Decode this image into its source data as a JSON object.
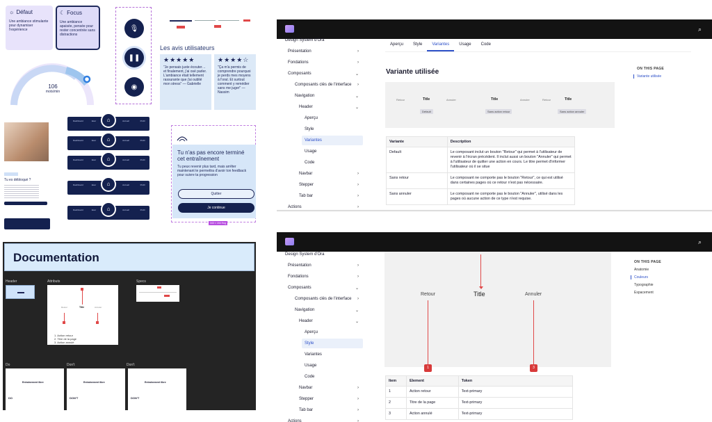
{
  "collage": {
    "card_default": {
      "title": "Défaut",
      "text": "Une ambiance stimulante pour dynamiser l'expérience"
    },
    "card_focus": {
      "title": "Focus",
      "text": "Une ambiance apaisée, pensée pour rester concentrée sans distractions"
    },
    "gauge": {
      "value": "106",
      "unit": "mots/min"
    },
    "avis_title": "Les avis utilisateurs",
    "reviews": [
      {
        "stars": "★★★★★",
        "text": "\"Je pensais juste écouter… et finalement, j'ai osé parler. L'ambiance était tellement rassurante que j'ai oublié mon stress\" — Gabrielle"
      },
      {
        "stars": "★★★★☆",
        "text": "\"Ça m'a permis de comprendre pourquoi je perds mes moyens à l'oral. Et surtout comment y remédier sans me juger\" — Nassim"
      }
    ],
    "navbar_labels": [
      "Dashboard",
      "Exer",
      "Accueil",
      "Profil"
    ],
    "phone_title": "Tu es débloqué ?",
    "modal": {
      "title": "Tu n'as pas encore terminé cet entraînement",
      "text": "Tu peux revenir plus tard, mais arrêter maintenant te permettra d'avoir ton feedback pour suivre ta progression",
      "quit": "Quitter",
      "continue": "Je continue",
      "size": "343 × 154 Hug"
    },
    "documentation": {
      "title": "Documentation",
      "labels": {
        "header": "Header",
        "attributs": "Attributs",
        "specs": "Specs",
        "do": "Do",
        "dont1": "Don't",
        "dont2": "Don't"
      },
      "attr_list": [
        "1. Action retour",
        "2. Titre de la page",
        "3. Action annulé"
      ],
      "attr_row": [
        "Retour",
        "Title",
        "Annuler"
      ],
      "card_titles": [
        "Entraînement libre",
        "Entraînement libre",
        "Entraînement libre"
      ],
      "card_tags": [
        "DO",
        "DON'T",
        "DON'T"
      ]
    }
  },
  "panel1": {
    "site_title": "Design System d'Ora",
    "sidebar": [
      {
        "label": "Présentation",
        "chev": "›"
      },
      {
        "label": "Fondations",
        "chev": "›"
      },
      {
        "label": "Composants",
        "chev": "⌄"
      },
      {
        "label": "Composants clés de l'interface",
        "chev": "›"
      },
      {
        "label": "Navigation",
        "chev": "⌄"
      },
      {
        "label": "Header",
        "chev": "⌄"
      },
      {
        "label": "Aperçu",
        "chev": ""
      },
      {
        "label": "Style",
        "chev": ""
      },
      {
        "label": "Variantes",
        "chev": ""
      },
      {
        "label": "Usage",
        "chev": ""
      },
      {
        "label": "Code",
        "chev": ""
      },
      {
        "label": "Navbar",
        "chev": "›"
      },
      {
        "label": "Stepper",
        "chev": "›"
      },
      {
        "label": "Tab bar",
        "chev": "›"
      },
      {
        "label": "Actions",
        "chev": "›"
      }
    ],
    "tabs": [
      "Aperçu",
      "Style",
      "Variantes",
      "Usage",
      "Code"
    ],
    "heading": "Variante utilisée",
    "otp_title": "ON THIS PAGE",
    "otp_items": [
      "Variante utilisée"
    ],
    "preview": {
      "retour": "Retour",
      "title": "Title",
      "annuler": "Annuler",
      "chips": [
        "Default",
        "Sans action retour",
        "Sans action annuler"
      ]
    },
    "table": {
      "headers": [
        "Variante",
        "Description"
      ],
      "rows": [
        [
          "Default",
          "Le composant inclut un bouton \"Retour\" qui permet à l'utilisateur de revenir à l'écran précédent. Il inclut aussi un bouton \"Annuler\" qui permet à l'utilisateur de quitter une action en cours. Le titre permet d'informer l'utilisateur où il se situe"
        ],
        [
          "Sans retour",
          "Le composant ne comporte pas le bouton \"Retour\", ce qui est utilisé dans certaines pages où ce retour n'est pas nécessaire."
        ],
        [
          "Sans annuler",
          "Le composant ne comporte pas le bouton \"Annuler\", utilisé dans les pages où aucune action de ce type n'est requise."
        ]
      ]
    }
  },
  "panel2": {
    "site_title": "Design System d'Ora",
    "otp_title": "ON THIS PAGE",
    "otp_items": [
      "Anatomie",
      "Couleurs",
      "Typographie",
      "Espacement"
    ],
    "anatomy": {
      "retour": "Retour",
      "title": "Title",
      "annuler": "Annuler",
      "badge1": "1",
      "badge3": "3"
    },
    "table": {
      "headers": [
        "Item",
        "Element",
        "Token"
      ],
      "rows": [
        [
          "1",
          "Action retour",
          "Text-primary"
        ],
        [
          "2",
          "Titre de la page",
          "Text-primary"
        ],
        [
          "3",
          "Action annulé",
          "Text-primary"
        ]
      ]
    }
  }
}
